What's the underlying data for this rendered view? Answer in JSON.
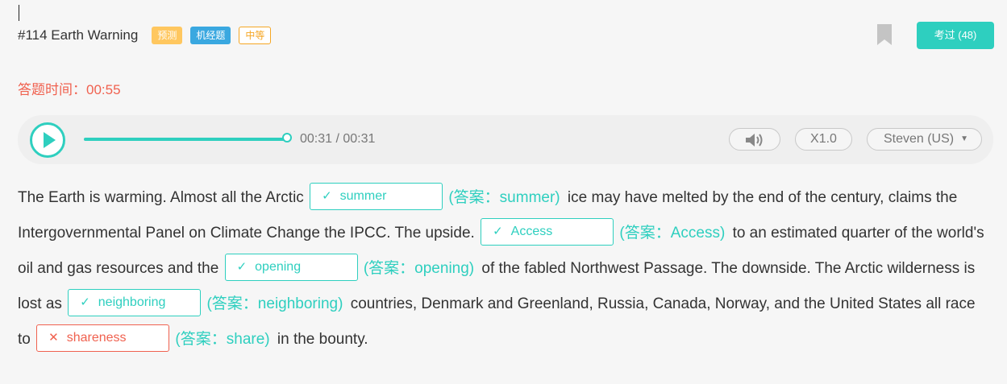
{
  "header": {
    "title": "#114 Earth Warning",
    "tags": [
      "预测",
      "机经题",
      "中等"
    ],
    "passed_button": "考过 (48)"
  },
  "timer": "答题时间：00:55",
  "player": {
    "time": "00:31 / 00:31",
    "progress": 1.0,
    "speed": "X1.0",
    "voice": "Steven (US)"
  },
  "passage": {
    "t0": "The Earth is warming. Almost all the Arctic",
    "b1": {
      "value": "summer",
      "answer": "(答案：summer)",
      "correct": true
    },
    "t1": "ice may have melted by the end of the century, claims the Intergovernmental Panel on Climate Change the IPCC. The upside.",
    "b2": {
      "value": "Access",
      "answer": "(答案：Access)",
      "correct": true
    },
    "t2": "to an estimated quarter of the world's oil and gas resources and the",
    "b3": {
      "value": "opening",
      "answer": "(答案：opening)",
      "correct": true
    },
    "t3": "of the fabled Northwest Passage. The downside. The Arctic wilderness is lost as",
    "b4": {
      "value": "neighboring",
      "answer": "(答案：neighboring)",
      "correct": true
    },
    "t4": "countries, Denmark and Greenland, Russia, Canada, Norway, and the United States all race to",
    "b5": {
      "value": "shareness",
      "answer": "(答案：share)",
      "correct": false
    },
    "t5": "in the bounty."
  },
  "icons": {
    "check": "✓",
    "cross": "✕",
    "bookmark": "bookmark-icon",
    "play": "play-icon",
    "volume": "speaker-icon",
    "dropdown": "caret-down-icon"
  },
  "colors": {
    "accent": "#2ecfbf",
    "error": "#f0614f",
    "tag_yellow": "#ffc75f",
    "tag_blue": "#3aa8e0",
    "tag_orange": "#f5a623"
  }
}
